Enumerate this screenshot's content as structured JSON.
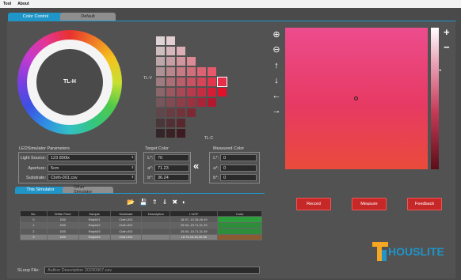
{
  "menu": [
    "Tool",
    "About"
  ],
  "top_tabs": [
    "Color Control",
    "Default"
  ],
  "wheel": {
    "label": "TL-H"
  },
  "grid_axes": {
    "v": "TL-V",
    "c": "TL-C"
  },
  "led_params": {
    "title": "LEDSimulator Parameters",
    "light_source_label": "Light Source:",
    "light_source": "123 800lx",
    "aperture_label": "Aperture:",
    "aperture": "5cm",
    "substrate_label": "Substrate:",
    "substrate": "Cloth-001.csv"
  },
  "target": {
    "title": "Target Color",
    "L_label": "L*:",
    "L": "70",
    "a_label": "a*:",
    "a": "71.23",
    "b_label": "b*:",
    "b": "36.24"
  },
  "measured": {
    "title": "Measured Color",
    "L_label": "L*:",
    "L": "0",
    "a_label": "a*:",
    "a": "0",
    "b_label": "b*:",
    "b": "0"
  },
  "buttons": {
    "record": "Record",
    "measure": "Measure",
    "feedback": "Feedback"
  },
  "bottom_tabs": [
    "This Simulator",
    "Other Simulator"
  ],
  "table": {
    "headers": [
      "No.",
      "White Point",
      "Sample",
      "Substrate",
      "Description",
      "L*a*b*",
      "Color"
    ],
    "rows": [
      {
        "no": "0",
        "wp": "D50",
        "sample": "Ralph01",
        "substrate": "Cloth-001",
        "desc": "",
        "lab": "18.97,-10.36,45.49",
        "color": "#2c9f3c"
      },
      {
        "no": "1",
        "wp": "D50",
        "sample": "Ralph02",
        "substrate": "Cloth-001",
        "desc": "",
        "lab": "25.50,-15.71,31.39",
        "color": "#2d8d3a"
      },
      {
        "no": "2",
        "wp": "D50",
        "sample": "Ralph03",
        "substrate": "Cloth-001",
        "desc": "",
        "lab": "25.50,-15.71,31.39",
        "color": "#2d8d3a"
      },
      {
        "no": "3",
        "wp": "D50",
        "sample": "Ralph04",
        "substrate": "Cloth-001",
        "desc": "",
        "lab": "18.75,18.45,26.36",
        "color": "#8a5a30"
      }
    ]
  },
  "loop": {
    "label": "SLoop File:",
    "value": "Author Description 20200907.csv"
  },
  "logo": {
    "text": "HOUSLITE"
  },
  "colors": {
    "accent": "#1f95c8",
    "button": "#c62828"
  }
}
